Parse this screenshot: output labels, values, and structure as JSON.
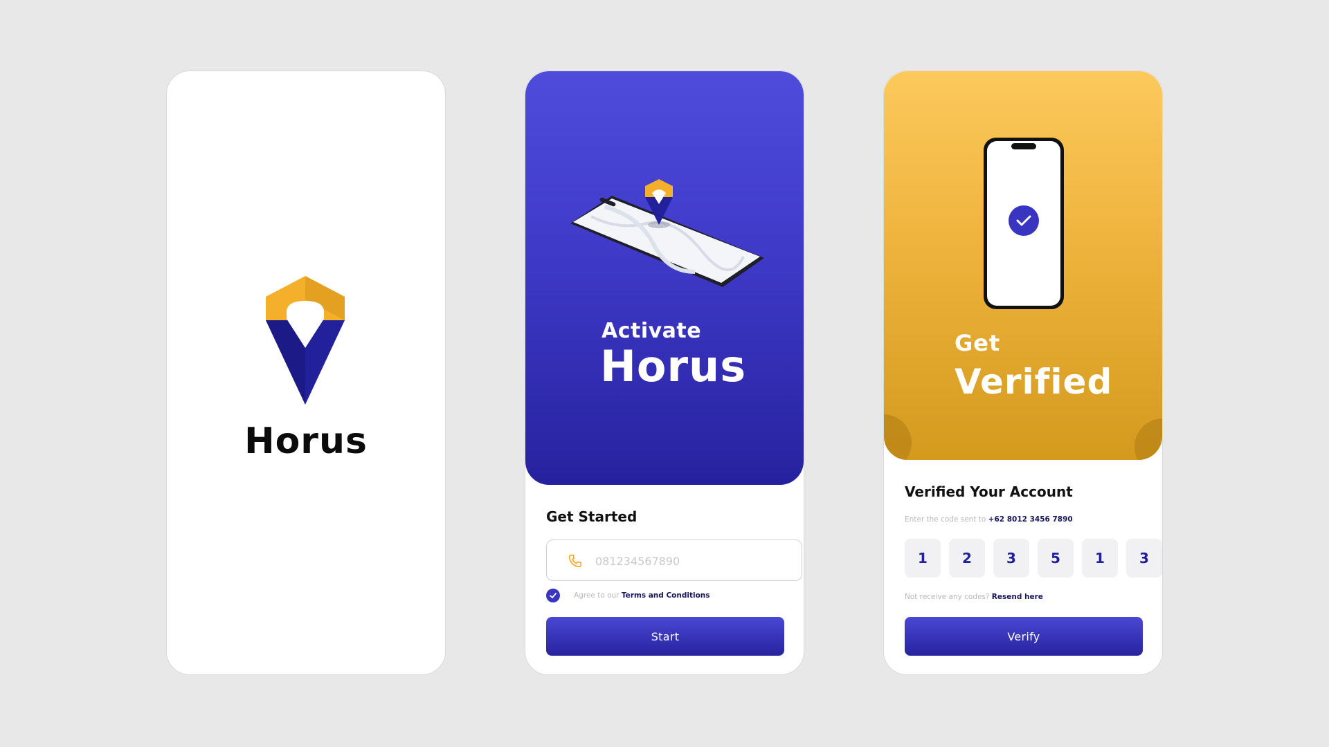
{
  "splash": {
    "brand_name": "Horus"
  },
  "activate": {
    "hero_small": "Activate",
    "hero_big": "Horus",
    "section_title": "Get Started",
    "phone_placeholder": "081234567890",
    "terms_prefix": "Agree to our ",
    "terms_link": "Terms and Conditions",
    "terms_checked": true,
    "start_label": "Start"
  },
  "verify": {
    "hero_small": "Get",
    "hero_big": "Verified",
    "section_title": "Verified Your Account",
    "code_prefix": "Enter the code sent to ",
    "phone_number": "+62 8012 3456 7890",
    "code_digits": [
      "1",
      "2",
      "3",
      "5",
      "1",
      "3"
    ],
    "resend_prefix": "Not receive any codes? ",
    "resend_link": "Resend here",
    "verify_label": "Verify"
  },
  "colors": {
    "background": "#e8e8e9",
    "brand_blue": "#3a35c0",
    "brand_blue_dark": "#22209a",
    "brand_gold": "#f2b52f"
  },
  "icons": [
    "horus-logo-icon",
    "phone-icon",
    "check-icon",
    "map-pin-icon",
    "smartphone-icon"
  ]
}
